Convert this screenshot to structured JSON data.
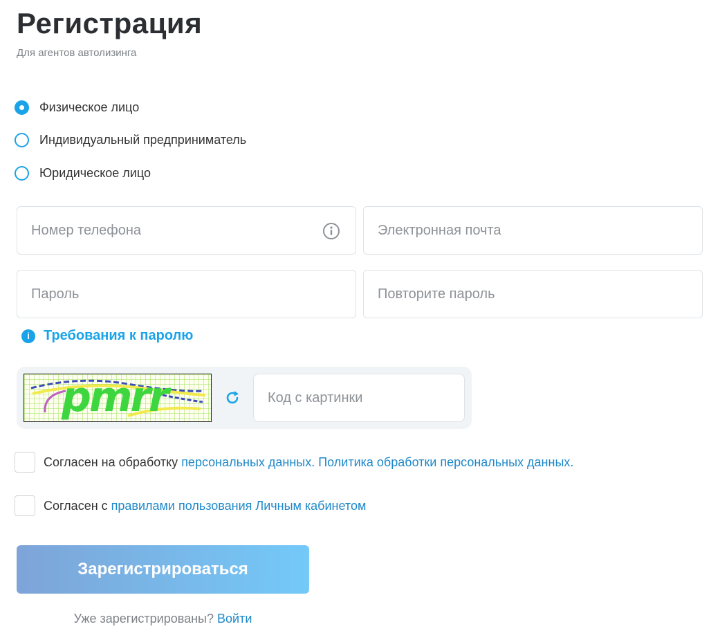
{
  "header": {
    "title": "Регистрация",
    "subtitle": "Для агентов автолизинга"
  },
  "entity_type": {
    "selected": "Физическое лицо",
    "options": [
      "Физическое лицо",
      "Индивидуальный предприниматель",
      "Юридическое лицо"
    ]
  },
  "fields": {
    "phone_placeholder": "Номер телефона",
    "email_placeholder": "Электронная почта",
    "password_placeholder": "Пароль",
    "password_repeat_placeholder": "Повторите пароль"
  },
  "password_requirements": {
    "label": "Требования к паролю"
  },
  "captcha": {
    "code": "pmrr",
    "placeholder": "Код с картинки"
  },
  "consents": {
    "personal_data": {
      "prefix": "Согласен на обработку ",
      "link1": "персональных данных.",
      "link2": " Политика обработки персональных данных."
    },
    "terms": {
      "prefix": "Согласен с ",
      "link": "правилами пользования Личным кабинетом"
    }
  },
  "submit": {
    "label": "Зарегистрироваться"
  },
  "login": {
    "text": "Уже зарегистрированы? ",
    "link": "Войти"
  },
  "colors": {
    "accent": "#1aa3e8",
    "link": "#1e88c9",
    "title": "#2b2f33",
    "button_start": "#7ea4d8",
    "button_end": "#73c9f8"
  },
  "icons": [
    "info-icon",
    "refresh-icon",
    "info-circle-icon"
  ]
}
